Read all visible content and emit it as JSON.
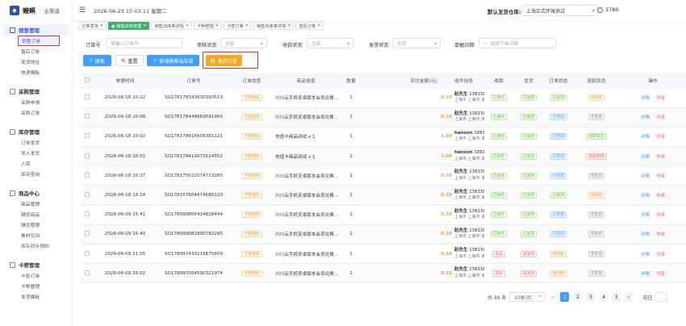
{
  "brand": {
    "name": "蝗蝌",
    "sep": "|",
    "sub": "全渠道"
  },
  "topbar": {
    "datetime": "2026-06-23 15:03:11 星期二",
    "warehouse_label": "默认发货仓库:",
    "warehouse_value": "上海正式环境测试",
    "user": "1780"
  },
  "sidebar": {
    "sections": [
      {
        "title": "销售管理",
        "active": true,
        "items": [
          "销售订单",
          "售后订单",
          "发货地址",
          "快递模板"
        ]
      },
      {
        "title": "采购管理",
        "items": [
          "采购申请",
          "采购订单"
        ]
      },
      {
        "title": "库存管理",
        "items": [
          "订单发货",
          "导入发货",
          "入库",
          "库存查询"
        ]
      },
      {
        "title": "商品中心",
        "items": [
          "商品管理",
          "辅货商品",
          "辅货管理",
          "素材空间",
          "库存同步规则"
        ]
      },
      {
        "title": "卡密管理",
        "items": [
          "卡密订单",
          "卡种管理",
          "发货模板"
        ]
      }
    ],
    "selected": "销售订单"
  },
  "tabs": [
    {
      "label": "订单发货"
    },
    {
      "label": "● 销售出库管理",
      "active": true
    },
    {
      "label": "销售出库单详情"
    },
    {
      "label": "卡种管理"
    },
    {
      "label": "卡密订单"
    },
    {
      "label": "销售出库单详情"
    },
    {
      "label": "售后订单"
    }
  ],
  "filters": {
    "order_no_label": "订单号",
    "order_no_placeholder": "请输入订单号",
    "audit_label": "审核状态",
    "audit_value": "全部",
    "pay_label": "收款状态",
    "pay_value": "全部",
    "ship_label": "发货状态",
    "ship_value": "全部",
    "date_label": "单据日期",
    "date_placeholder": "选择下单日期"
  },
  "buttons": {
    "search": "搜索",
    "reset": "重置",
    "add": "新增销售出库单",
    "aftersale": "售后订单"
  },
  "table": {
    "headers": [
      "单据时间",
      "订单号",
      "订单类型",
      "商品信息",
      "数量",
      "实付金额(元)",
      "收件信息",
      "收款",
      "发货",
      "订单状态",
      "退款状态",
      "操作"
    ],
    "rows": [
      {
        "time": "2026-06-18 20:22",
        "no": "SO178178343630393513",
        "type": "卡密虚拟",
        "goods": "川川云手机安卓版本会员兑换...",
        "qty": "1",
        "amount": "0.10",
        "name": "赵先生",
        "phone": "13815865955",
        "addr": "上海市 上海市 浦东新区",
        "pay": "已收齐",
        "ship": "已发货",
        "status": "已发货",
        "refund": "待退款"
      },
      {
        "time": "2026-06-18 20:08",
        "no": "SO178178448669591460",
        "type": "卡密虚拟",
        "goods": "川川云手机安卓版本会员兑换...",
        "qty": "1",
        "amount": "0.10",
        "name": "赵先生",
        "phone": "13815865955",
        "addr": "上海市 上海市 浦东新区",
        "pay": "已收齐",
        "ship": "已发货",
        "status": "已完成",
        "refund": "无售后"
      },
      {
        "time": "2026-06-18 20:02",
        "no": "SO178178416606361121",
        "type": "卡密虚拟",
        "goods": "充值卡商品测试 x 1",
        "qty": "1",
        "amount": "1.00",
        "name": "hanson",
        "phone": "18817834074",
        "addr": "上海市 上海市 浦东新区",
        "pay": "已收齐",
        "ship": "已发货",
        "status": "已完成",
        "refund": "退款成功"
      },
      {
        "time": "2026-06-18 20:01",
        "no": "SO178178410071514552",
        "type": "卡密虚拟",
        "goods": "充值卡商品测试 x 1",
        "qty": "1",
        "amount": "1.00",
        "name": "hanson",
        "phone": "18817834074",
        "addr": "上海市 上海市 浦东新区",
        "pay": "已收齐",
        "ship": "已发货",
        "status": "已完成",
        "refund": "卖家拒绝"
      },
      {
        "time": "2026-06-18 10:37",
        "no": "SO178175022574713285",
        "type": "卡密虚拟",
        "goods": "川川云手机安卓版本会员兑换...",
        "qty": "1",
        "amount": "0.10",
        "name": "赵先生",
        "phone": "13815865955",
        "addr": "上海市 上海市 浦东新区",
        "pay": "已收齐",
        "ship": "已发货",
        "status": "已完成",
        "refund": "无售后"
      },
      {
        "time": "2026-06-18 10:14",
        "no": "SO178157604674680120",
        "type": "卡密虚拟",
        "goods": "川川云手机安卓版本会员兑换...",
        "qty": "1",
        "amount": "0.10",
        "name": "赵先生",
        "phone": "13815865955",
        "addr": "上海市 上海市 浦东新区",
        "pay": "已收齐",
        "ship": "已发货",
        "status": "已发货",
        "refund": "待退款"
      },
      {
        "time": "2026-06-09 15:41",
        "no": "SO178099806434818444",
        "type": "卡密虚拟",
        "goods": "川川云手机安卓版本会员兑换...",
        "qty": "1",
        "amount": "0.10",
        "name": "赵先生",
        "phone": "13815865955",
        "addr": "上海市 上海市 浦东新区",
        "pay": "已收齐",
        "ship": "已发货",
        "status": "已完成",
        "refund": "无售后"
      },
      {
        "time": "2026-06-09 15:40",
        "no": "SO178099082800782295",
        "type": "卡密虚拟",
        "goods": "川川云手机安卓版本会员兑换...",
        "qty": "1",
        "amount": "0.10",
        "name": "赵先生",
        "phone": "13815865955",
        "addr": "上海市 上海市 浦东新区",
        "pay": "已收齐",
        "ship": "已发货",
        "status": "已完成",
        "refund": "无售后"
      },
      {
        "time": "2026-06-09 11:05",
        "no": "SO178097433216875609",
        "type": "卡密虚拟",
        "goods": "川川云手机安卓版本会员兑换...",
        "qty": "1",
        "amount": "0.10",
        "name": "赵先生",
        "phone": "13815865955",
        "addr": "上海市 上海市 浦东新区",
        "pay": "未收",
        "ship": "未发货",
        "status": "待付款",
        "refund": "无售后"
      },
      {
        "time": "2026-06-09 10:02",
        "no": "SO178097054590321974",
        "type": "卡密虚拟",
        "goods": "川川云手机安卓版本会员兑换...",
        "qty": "1",
        "amount": "0.10",
        "name": "赵先生",
        "phone": "13815865955",
        "addr": "上海市 上海市 浦东新区",
        "pay": "未收",
        "ship": "未发货",
        "status": "待付款",
        "refund": "无售后"
      }
    ],
    "action_detail": "详情",
    "action_void": "作废"
  },
  "pagination": {
    "total": "共 49 条",
    "size": "10条/页",
    "pages": [
      "1",
      "2",
      "3",
      "4",
      "5"
    ],
    "current": "1",
    "prev": "‹",
    "next": "›",
    "goto": "前往"
  },
  "colors": {
    "primary": "#409eff",
    "warning": "#f5a623",
    "success": "#3db06b",
    "danger": "#f56c6c"
  }
}
